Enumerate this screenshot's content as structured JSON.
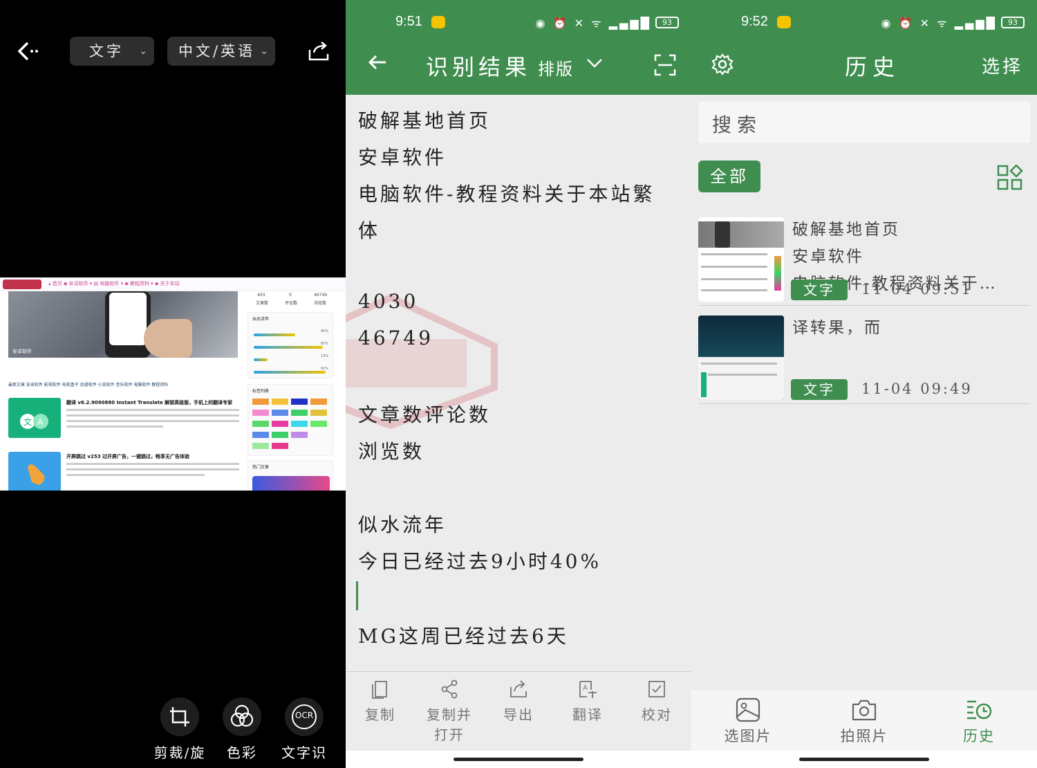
{
  "panel_camera": {
    "mode_select": "文字",
    "lang_select": "中文/英语",
    "tools": [
      {
        "label": "剪裁/旋"
      },
      {
        "label": "色彩"
      },
      {
        "label": "文字识",
        "badge": "OCR"
      }
    ],
    "webpage": {
      "hero_label": "安卓软件",
      "stats": [
        "403",
        "0",
        "46749"
      ],
      "stat_labels": [
        "文章数",
        "评论数",
        "浏览数"
      ],
      "tabs": "最新文章  安卓软件  影视软件  电视盒子  动漫软件  小说软件  音乐软件  电脑软件  教程资料",
      "article1_title": "翻译 v6.2.9090880 Instant Translate 解锁高级版，手机上的翻译专家",
      "article2_title": "开屏跳过 v253 过开屏广告，一键跳过，畅享无广告体验",
      "side_title": "似水流年",
      "side_title2": "标签列表",
      "side_title3": "热门文章",
      "percents": [
        "40%",
        "85%",
        "13%",
        "91%"
      ]
    }
  },
  "panel_result": {
    "status": {
      "time": "9:51",
      "battery": "93"
    },
    "title": "识别结果",
    "layout_mode": "排版",
    "lines": [
      "破解基地首页",
      "安卓软件",
      "电脑软件-教程资料关于本站繁",
      "体",
      "4030",
      "46749",
      "文章数评论数",
      "浏览数",
      "似水流年",
      "今日已经过去9小时40%",
      "MG这周已经过去6天"
    ],
    "actions": [
      {
        "label": "复制"
      },
      {
        "label": "复制并",
        "label2": "打开"
      },
      {
        "label": "导出"
      },
      {
        "label": "翻译"
      },
      {
        "label": "校对"
      }
    ]
  },
  "panel_history": {
    "status": {
      "time": "9:52",
      "battery": "93"
    },
    "title": "历史",
    "select": "选择",
    "search_placeholder": "搜索",
    "filter_all": "全部",
    "items": [
      {
        "lines": [
          "破解基地首页",
          "安卓软件",
          "电脑软件-教程资料关于…"
        ],
        "tag": "文字",
        "date": "11-04 09:51"
      },
      {
        "lines": [
          "译转果，而"
        ],
        "tag": "文字",
        "date": "11-04 09:49"
      }
    ],
    "nav": [
      {
        "label": "选图片"
      },
      {
        "label": "拍照片"
      },
      {
        "label": "历史"
      }
    ]
  },
  "colors": {
    "primary_green": "#3f8e4f",
    "bg": "#ececec"
  }
}
